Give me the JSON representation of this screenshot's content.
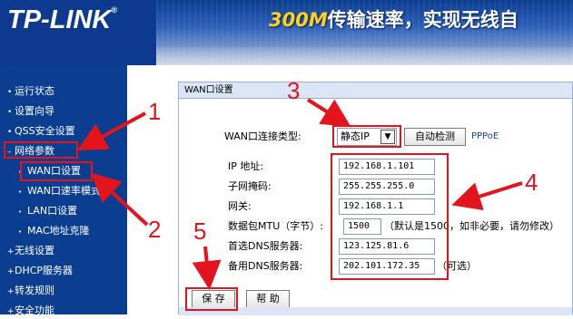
{
  "header": {
    "logo": "TP-LINK",
    "logo_mark": "®",
    "banner_speed": "300M",
    "banner_text": "传输速率，实现无线自"
  },
  "sidebar": {
    "items": [
      {
        "label": "运行状态",
        "bullet": "•"
      },
      {
        "label": "设置向导",
        "bullet": "•"
      },
      {
        "label": "QSS安全设置",
        "bullet": "•"
      },
      {
        "label": "网络参数",
        "bullet": "–"
      },
      {
        "label": "无线设置",
        "bullet": "+"
      },
      {
        "label": "DHCP服务器",
        "bullet": "+"
      },
      {
        "label": "转发规则",
        "bullet": "+"
      },
      {
        "label": "安全功能",
        "bullet": "+"
      }
    ],
    "subitems": [
      {
        "label": "WAN口设置",
        "bullet": "•"
      },
      {
        "label": "WAN口速率模式",
        "bullet": "•"
      },
      {
        "label": "LAN口设置",
        "bullet": "•"
      },
      {
        "label": "MAC地址克隆",
        "bullet": "•"
      }
    ]
  },
  "panel": {
    "title": "WAN口设置",
    "connection_type_label": "WAN口连接类型:",
    "connection_type_value": "静态IP",
    "auto_detect_button": "自动检测",
    "pppoe_label": "PPPoE",
    "fields": [
      {
        "label": "IP 地址:",
        "value": "192.168.1.101"
      },
      {
        "label": "子网掩码:",
        "value": "255.255.255.0"
      },
      {
        "label": "网关:",
        "value": "192.168.1.1"
      },
      {
        "label": "数据包MTU（字节）:",
        "value": "1500",
        "hint": "（默认是1500，如非必要，请勿修改）"
      },
      {
        "label": "首选DNS服务器:",
        "value": "123.125.81.6"
      },
      {
        "label": "备用DNS服务器:",
        "value": "202.101.172.35",
        "hint": "（可选）"
      }
    ],
    "save_button": "保 存",
    "help_button": "帮 助"
  },
  "annotations": {
    "numbers": [
      "1",
      "2",
      "3",
      "4",
      "5"
    ],
    "color": "#e3141b"
  },
  "colors": {
    "sidebar": "#0b3d91",
    "panel_header": "#dbe5f5",
    "banner_highlight": "#ffd21a"
  }
}
